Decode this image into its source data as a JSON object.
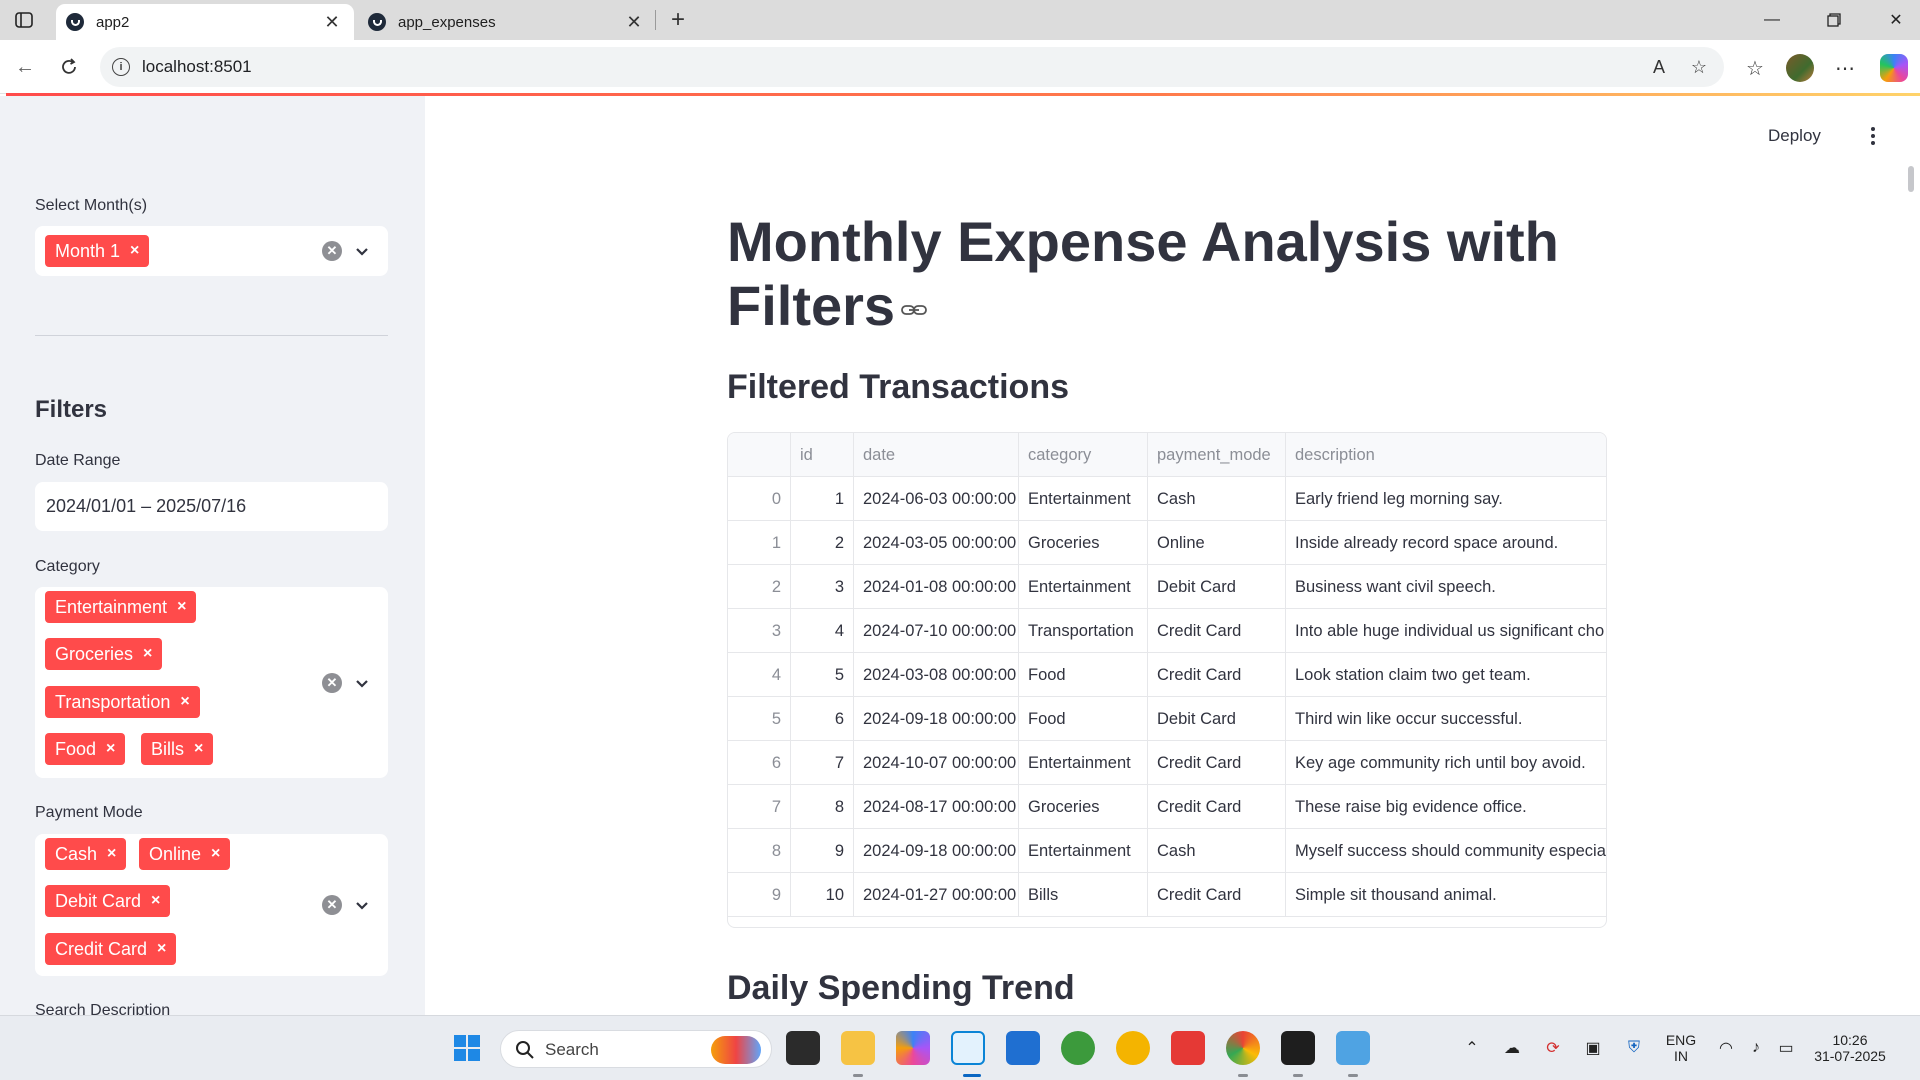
{
  "browser": {
    "tabs": [
      {
        "title": "app2",
        "active": true
      },
      {
        "title": "app_expenses",
        "active": false
      }
    ],
    "url": "localhost:8501"
  },
  "header": {
    "deploy_label": "Deploy"
  },
  "sidebar": {
    "month_label": "Select Month(s)",
    "month_selected": [
      "Month 1"
    ],
    "filters_heading": "Filters",
    "date_range_label": "Date Range",
    "date_range_value": "2024/01/01 – 2025/07/16",
    "category_label": "Category",
    "categories_selected": [
      "Entertainment",
      "Groceries",
      "Transportation",
      "Food",
      "Bills"
    ],
    "payment_label": "Payment Mode",
    "payments_selected": [
      "Cash",
      "Online",
      "Debit Card",
      "Credit Card"
    ],
    "search_label": "Search Description",
    "chip_remove_glyph": "×"
  },
  "main": {
    "title_line1": "Monthly Expense Analysis with",
    "title_line2": "Filters",
    "table_heading": "Filtered Transactions",
    "trend_heading": "Daily Spending Trend"
  },
  "table": {
    "columns": [
      "",
      "id",
      "date",
      "category",
      "payment_mode",
      "description"
    ],
    "rows": [
      [
        "0",
        "1",
        "2024-06-03 00:00:00",
        "Entertainment",
        "Cash",
        "Early friend leg morning say."
      ],
      [
        "1",
        "2",
        "2024-03-05 00:00:00",
        "Groceries",
        "Online",
        "Inside already record space around."
      ],
      [
        "2",
        "3",
        "2024-01-08 00:00:00",
        "Entertainment",
        "Debit Card",
        "Business want civil speech."
      ],
      [
        "3",
        "4",
        "2024-07-10 00:00:00",
        "Transportation",
        "Credit Card",
        "Into able huge individual us significant cho"
      ],
      [
        "4",
        "5",
        "2024-03-08 00:00:00",
        "Food",
        "Credit Card",
        "Look station claim two get team."
      ],
      [
        "5",
        "6",
        "2024-09-18 00:00:00",
        "Food",
        "Debit Card",
        "Third win like occur successful."
      ],
      [
        "6",
        "7",
        "2024-10-07 00:00:00",
        "Entertainment",
        "Credit Card",
        "Key age community rich until boy avoid."
      ],
      [
        "7",
        "8",
        "2024-08-17 00:00:00",
        "Groceries",
        "Credit Card",
        "These raise big evidence office."
      ],
      [
        "8",
        "9",
        "2024-09-18 00:00:00",
        "Entertainment",
        "Cash",
        "Myself success should community especial"
      ],
      [
        "9",
        "10",
        "2024-01-27 00:00:00",
        "Bills",
        "Credit Card",
        "Simple sit thousand animal."
      ]
    ]
  },
  "taskbar": {
    "search_placeholder": "Search",
    "lang_line1": "ENG",
    "lang_line2": "IN",
    "time": "10:26",
    "date": "31-07-2025"
  },
  "colors": {
    "accent": "#ff4b4b",
    "sidebar_bg": "#f0f2f6",
    "text": "#31333f"
  },
  "icons": {
    "tray": [
      "chevron-up-icon",
      "onedrive-icon",
      "sync-icon",
      "vpn-icon",
      "defender-icon",
      "wifi-icon",
      "volume-icon",
      "battery-icon"
    ]
  }
}
